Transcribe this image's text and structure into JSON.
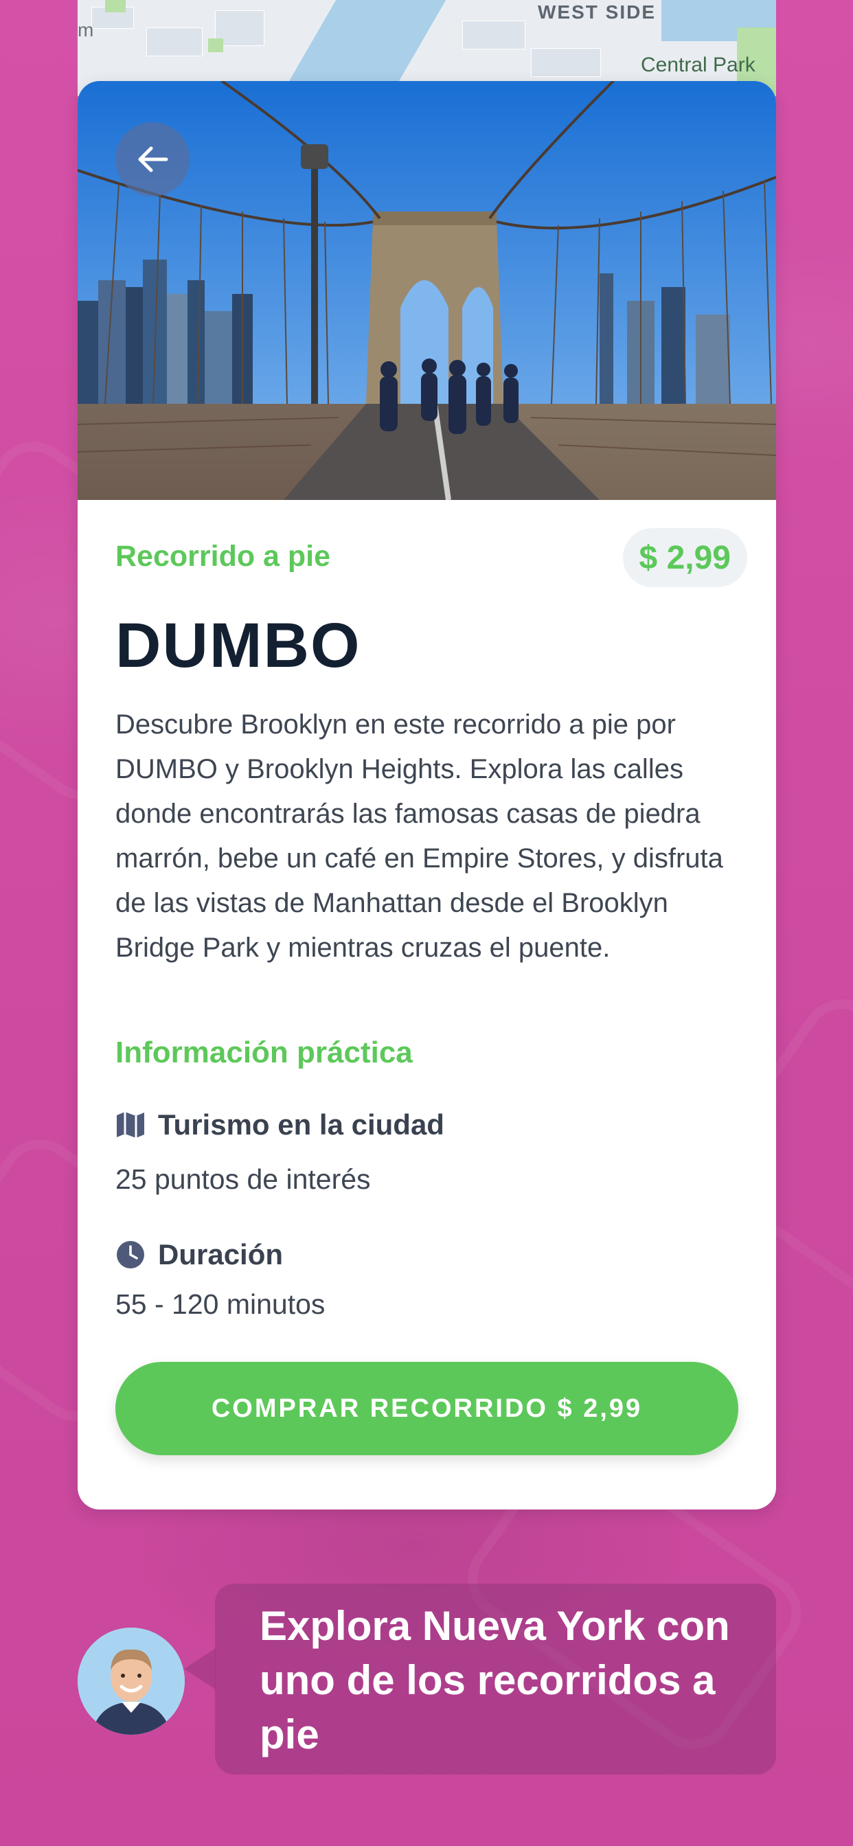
{
  "map": {
    "label_area": "WEST SIDE",
    "label_park": "Central Park",
    "label_edge": "m"
  },
  "tour": {
    "category": "Recorrido a pie",
    "price": "$ 2,99",
    "title": "DUMBO",
    "description": "Descubre Brooklyn en este recorrido a pie por DUMBO y Brooklyn Heights. Explora las calles donde encontrarás las famosas casas de piedra marrón, bebe un café en Empire Stores, y disfruta de las vistas de Manhattan desde el Brooklyn Bridge Park y mientras cruzas el puente.",
    "practical_info_title": "Información práctica",
    "info": [
      {
        "label": "Turismo en la ciudad",
        "value": "25 puntos de interés",
        "icon": "map-icon"
      },
      {
        "label": "Duración",
        "value": "55 - 120 minutos",
        "icon": "clock-icon"
      }
    ],
    "buy_button": "COMPRAR RECORRIDO $ 2,99"
  },
  "promo": {
    "text": "Explora Nueva York con uno de los recorridos a pie"
  },
  "colors": {
    "background": "#d24fa4",
    "accent": "#5dc85a",
    "title": "#132031",
    "body_text": "#3e4652"
  }
}
